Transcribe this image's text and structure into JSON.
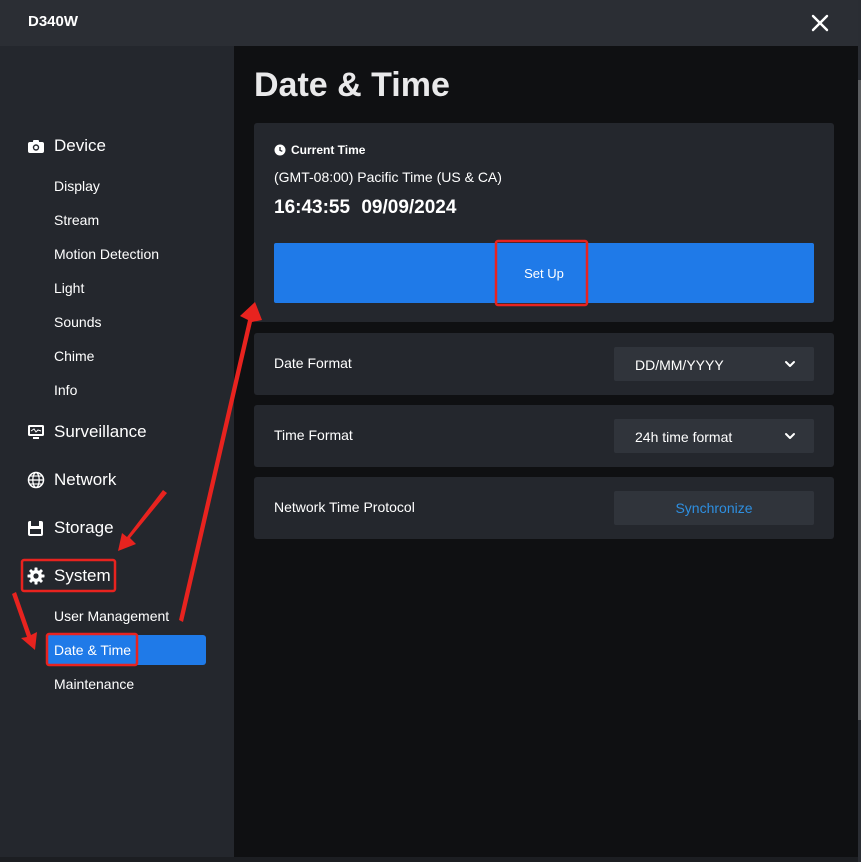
{
  "window": {
    "title": "D340W"
  },
  "sidebar": {
    "sections": [
      {
        "label": "Device",
        "icon": "camera-icon",
        "items": [
          "Display",
          "Stream",
          "Motion Detection",
          "Light",
          "Sounds",
          "Chime",
          "Info"
        ]
      },
      {
        "label": "Surveillance",
        "icon": "monitor-icon"
      },
      {
        "label": "Network",
        "icon": "globe-icon"
      },
      {
        "label": "Storage",
        "icon": "floppy-disk-icon"
      },
      {
        "label": "System",
        "icon": "gear-icon",
        "items": [
          "User Management",
          "Date & Time",
          "Maintenance"
        ]
      }
    ],
    "active_item": "Date & Time"
  },
  "main": {
    "page_title": "Date & Time",
    "current_time": {
      "heading": "Current Time",
      "timezone": "(GMT-08:00) Pacific Time (US & CA)",
      "time": "16:43:55",
      "date": "09/09/2024",
      "setup_label": "Set Up"
    },
    "date_format": {
      "label": "Date Format",
      "value": "DD/MM/YYYY"
    },
    "time_format": {
      "label": "Time Format",
      "value": "24h time format"
    },
    "ntp": {
      "label": "Network Time Protocol",
      "button_label": "Synchronize"
    }
  },
  "colors": {
    "accent": "#1f7ae8",
    "sidebar_bg": "#24272d",
    "main_bg": "#0f1012",
    "link": "#2e8fe0",
    "annotation": "#e8231f"
  }
}
